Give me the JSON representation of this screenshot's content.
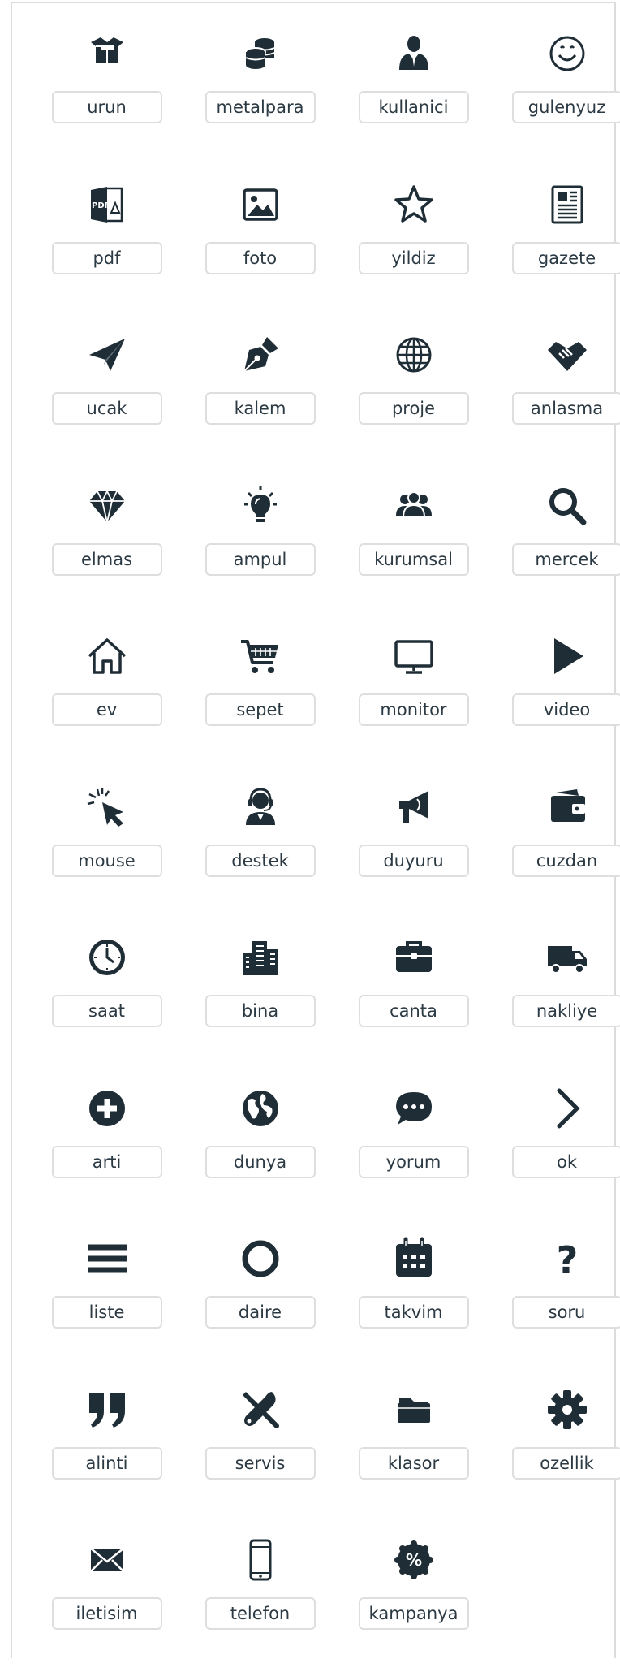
{
  "icons": [
    {
      "label": "urun",
      "icon": "box-icon"
    },
    {
      "label": "metalpara",
      "icon": "coins-icon"
    },
    {
      "label": "kullanici",
      "icon": "user-icon"
    },
    {
      "label": "gulenyuz",
      "icon": "smile-icon"
    },
    {
      "label": "pdf",
      "icon": "pdf-icon"
    },
    {
      "label": "foto",
      "icon": "image-icon"
    },
    {
      "label": "yildiz",
      "icon": "star-icon"
    },
    {
      "label": "gazete",
      "icon": "newspaper-icon"
    },
    {
      "label": "ucak",
      "icon": "paper-plane-icon"
    },
    {
      "label": "kalem",
      "icon": "pen-nib-icon"
    },
    {
      "label": "proje",
      "icon": "globe-grid-icon"
    },
    {
      "label": "anlasma",
      "icon": "handshake-icon"
    },
    {
      "label": "elmas",
      "icon": "diamond-icon"
    },
    {
      "label": "ampul",
      "icon": "lightbulb-icon"
    },
    {
      "label": "kurumsal",
      "icon": "users-group-icon"
    },
    {
      "label": "mercek",
      "icon": "search-icon"
    },
    {
      "label": "ev",
      "icon": "home-icon"
    },
    {
      "label": "sepet",
      "icon": "cart-icon"
    },
    {
      "label": "monitor",
      "icon": "monitor-icon"
    },
    {
      "label": "video",
      "icon": "play-icon"
    },
    {
      "label": "mouse",
      "icon": "cursor-click-icon"
    },
    {
      "label": "destek",
      "icon": "support-agent-icon"
    },
    {
      "label": "duyuru",
      "icon": "megaphone-icon"
    },
    {
      "label": "cuzdan",
      "icon": "wallet-icon"
    },
    {
      "label": "saat",
      "icon": "clock-icon"
    },
    {
      "label": "bina",
      "icon": "building-icon"
    },
    {
      "label": "canta",
      "icon": "briefcase-icon"
    },
    {
      "label": "nakliye",
      "icon": "truck-icon"
    },
    {
      "label": "arti",
      "icon": "plus-circle-icon"
    },
    {
      "label": "dunya",
      "icon": "earth-icon"
    },
    {
      "label": "yorum",
      "icon": "comment-icon"
    },
    {
      "label": "ok",
      "icon": "chevron-right-icon"
    },
    {
      "label": "liste",
      "icon": "list-icon"
    },
    {
      "label": "daire",
      "icon": "circle-icon"
    },
    {
      "label": "takvim",
      "icon": "calendar-icon"
    },
    {
      "label": "soru",
      "icon": "question-icon"
    },
    {
      "label": "alinti",
      "icon": "quote-icon"
    },
    {
      "label": "servis",
      "icon": "tools-icon"
    },
    {
      "label": "klasor",
      "icon": "folder-icon"
    },
    {
      "label": "ozellik",
      "icon": "gear-icon"
    },
    {
      "label": "iletisim",
      "icon": "envelope-icon"
    },
    {
      "label": "telefon",
      "icon": "phone-icon"
    },
    {
      "label": "kampanya",
      "icon": "percent-badge-icon"
    }
  ],
  "icon_color": "#1f2d36",
  "border_color": "#dedede"
}
